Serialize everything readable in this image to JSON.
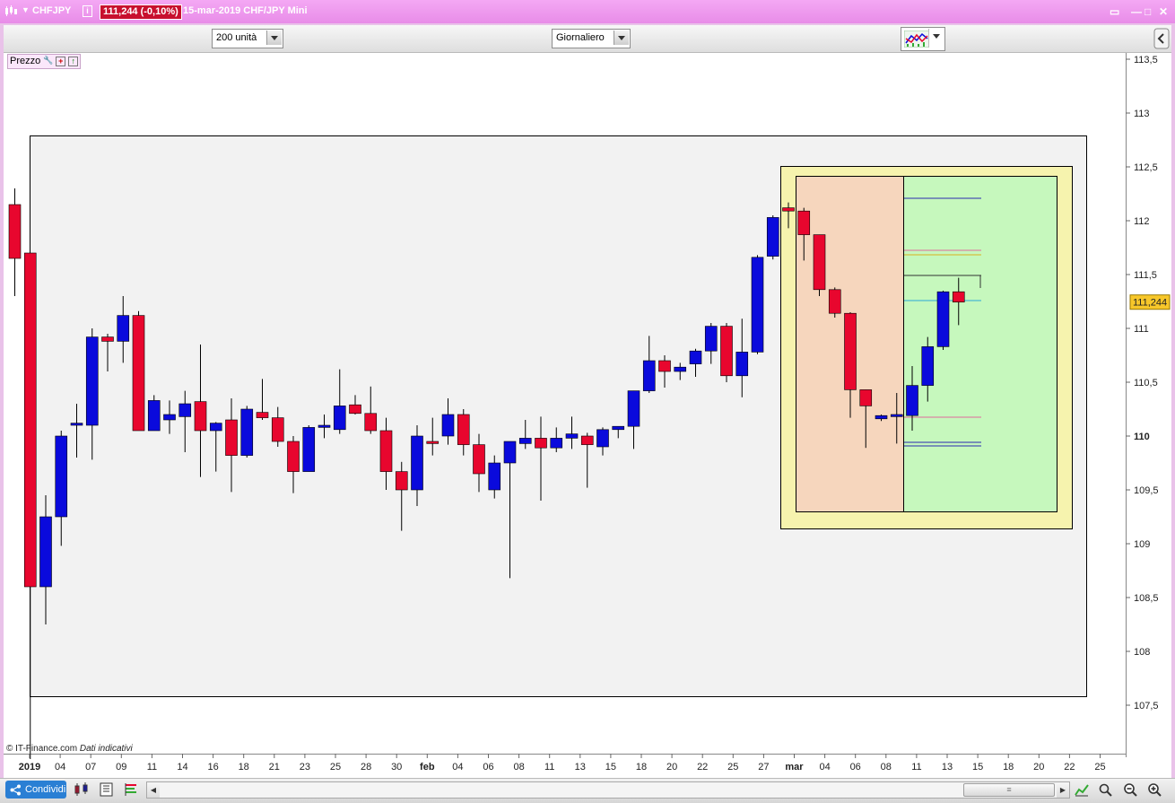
{
  "window": {
    "symbol": "CHFJPY",
    "info_label": "i",
    "price_badge": "111,244 (-0,10%)",
    "title": "15-mar-2019 CHF/JPY Mini",
    "win_buttons": [
      "▭",
      "—",
      "□",
      "✕"
    ]
  },
  "toolbar": {
    "units_value": "200 unità",
    "period_value": "Giornaliero"
  },
  "chart": {
    "panel_label": "Prezzo",
    "copyright": "© IT-Finance.com",
    "copyright_note": "Dati indicativi",
    "current_price_label": "111,244"
  },
  "bottombar": {
    "share_label": "Condividi",
    "scroll_thumb": "≡"
  },
  "colors": {
    "up": "#0a0adc",
    "down": "#e8062e",
    "price_tag": "#f7c72a",
    "outer_frame_bg": "#f2f2f2",
    "yellow_box": "#f6f3ae",
    "orange_zone": "#f6d6bd",
    "green_zone": "#c6f8bd"
  },
  "chart_data": {
    "type": "candlestick",
    "ylim": [
      107,
      113.6
    ],
    "y_ticks": [
      "113,5",
      "113",
      "112,5",
      "112",
      "111,5",
      "111",
      "110,5",
      "110",
      "109,5",
      "109",
      "108,5",
      "108",
      "107,5"
    ],
    "y_tick_values": [
      113.5,
      113,
      112.5,
      112,
      111.5,
      111,
      110.5,
      110,
      109.5,
      109,
      108.5,
      108,
      107.5
    ],
    "y_bold_tick": "110",
    "x_labels": [
      "2019",
      "04",
      "07",
      "09",
      "11",
      "14",
      "16",
      "18",
      "21",
      "23",
      "25",
      "28",
      "30",
      "feb",
      "04",
      "06",
      "08",
      "11",
      "13",
      "15",
      "18",
      "20",
      "22",
      "25",
      "27",
      "mar",
      "04",
      "06",
      "08",
      "11",
      "13",
      "15",
      "18",
      "20",
      "22",
      "25"
    ],
    "x_label_bold": [
      "2019",
      "feb",
      "mar"
    ],
    "last_price": 111.244,
    "candles": [
      {
        "o": 112.15,
        "h": 112.3,
        "l": 111.3,
        "c": 111.65
      },
      {
        "o": 111.7,
        "h": 111.7,
        "l": 107.0,
        "c": 108.6
      },
      {
        "o": 108.6,
        "h": 109.45,
        "l": 108.25,
        "c": 109.25
      },
      {
        "o": 109.25,
        "h": 110.05,
        "l": 108.98,
        "c": 110.0
      },
      {
        "o": 110.1,
        "h": 110.3,
        "l": 109.8,
        "c": 110.12
      },
      {
        "o": 110.1,
        "h": 111.0,
        "l": 109.78,
        "c": 110.92
      },
      {
        "o": 110.92,
        "h": 110.95,
        "l": 110.6,
        "c": 110.88
      },
      {
        "o": 110.88,
        "h": 111.3,
        "l": 110.68,
        "c": 111.12
      },
      {
        "o": 111.12,
        "h": 111.16,
        "l": 110.05,
        "c": 110.05
      },
      {
        "o": 110.05,
        "h": 110.38,
        "l": 110.05,
        "c": 110.33
      },
      {
        "o": 110.15,
        "h": 110.33,
        "l": 110.02,
        "c": 110.2
      },
      {
        "o": 110.18,
        "h": 110.42,
        "l": 109.85,
        "c": 110.3
      },
      {
        "o": 110.32,
        "h": 110.85,
        "l": 109.62,
        "c": 110.05
      },
      {
        "o": 110.05,
        "h": 110.13,
        "l": 109.67,
        "c": 110.12
      },
      {
        "o": 110.15,
        "h": 110.35,
        "l": 109.48,
        "c": 109.82
      },
      {
        "o": 109.82,
        "h": 110.28,
        "l": 109.8,
        "c": 110.25
      },
      {
        "o": 110.22,
        "h": 110.53,
        "l": 110.15,
        "c": 110.17
      },
      {
        "o": 110.17,
        "h": 110.27,
        "l": 109.9,
        "c": 109.95
      },
      {
        "o": 109.95,
        "h": 110.0,
        "l": 109.47,
        "c": 109.67
      },
      {
        "o": 109.67,
        "h": 110.1,
        "l": 109.67,
        "c": 110.08
      },
      {
        "o": 110.08,
        "h": 110.2,
        "l": 109.98,
        "c": 110.1
      },
      {
        "o": 110.06,
        "h": 110.62,
        "l": 110.02,
        "c": 110.28
      },
      {
        "o": 110.29,
        "h": 110.38,
        "l": 110.2,
        "c": 110.21
      },
      {
        "o": 110.21,
        "h": 110.46,
        "l": 110.02,
        "c": 110.05
      },
      {
        "o": 110.05,
        "h": 110.17,
        "l": 109.5,
        "c": 109.67
      },
      {
        "o": 109.67,
        "h": 109.76,
        "l": 109.12,
        "c": 109.5
      },
      {
        "o": 109.5,
        "h": 110.1,
        "l": 109.35,
        "c": 110.0
      },
      {
        "o": 109.95,
        "h": 110.17,
        "l": 109.82,
        "c": 109.93
      },
      {
        "o": 110.0,
        "h": 110.35,
        "l": 109.92,
        "c": 110.2
      },
      {
        "o": 110.2,
        "h": 110.25,
        "l": 109.82,
        "c": 109.92
      },
      {
        "o": 109.92,
        "h": 110.02,
        "l": 109.48,
        "c": 109.65
      },
      {
        "o": 109.5,
        "h": 109.82,
        "l": 109.42,
        "c": 109.75
      },
      {
        "o": 109.75,
        "h": 109.88,
        "l": 108.68,
        "c": 109.95
      },
      {
        "o": 109.93,
        "h": 110.15,
        "l": 109.88,
        "c": 109.98
      },
      {
        "o": 109.98,
        "h": 110.18,
        "l": 109.4,
        "c": 109.89
      },
      {
        "o": 109.89,
        "h": 110.08,
        "l": 109.85,
        "c": 109.98
      },
      {
        "o": 109.98,
        "h": 110.18,
        "l": 109.88,
        "c": 110.02
      },
      {
        "o": 110.0,
        "h": 110.03,
        "l": 109.52,
        "c": 109.92
      },
      {
        "o": 109.9,
        "h": 110.08,
        "l": 109.82,
        "c": 110.06
      },
      {
        "o": 110.06,
        "h": 110.08,
        "l": 109.98,
        "c": 110.09
      },
      {
        "o": 110.09,
        "h": 110.42,
        "l": 109.88,
        "c": 110.42
      },
      {
        "o": 110.42,
        "h": 110.93,
        "l": 110.4,
        "c": 110.7
      },
      {
        "o": 110.7,
        "h": 110.75,
        "l": 110.45,
        "c": 110.6
      },
      {
        "o": 110.6,
        "h": 110.68,
        "l": 110.52,
        "c": 110.64
      },
      {
        "o": 110.67,
        "h": 110.81,
        "l": 110.55,
        "c": 110.79
      },
      {
        "o": 110.79,
        "h": 111.05,
        "l": 110.67,
        "c": 111.02
      },
      {
        "o": 111.02,
        "h": 111.05,
        "l": 110.5,
        "c": 110.56
      },
      {
        "o": 110.56,
        "h": 111.09,
        "l": 110.36,
        "c": 110.78
      },
      {
        "o": 110.78,
        "h": 111.68,
        "l": 110.76,
        "c": 111.66
      },
      {
        "o": 111.67,
        "h": 112.05,
        "l": 111.64,
        "c": 112.03
      },
      {
        "o": 112.12,
        "h": 112.17,
        "l": 111.93,
        "c": 112.09
      },
      {
        "o": 112.09,
        "h": 112.12,
        "l": 111.63,
        "c": 111.87
      },
      {
        "o": 111.87,
        "h": 111.87,
        "l": 111.3,
        "c": 111.36
      },
      {
        "o": 111.36,
        "h": 111.38,
        "l": 111.1,
        "c": 111.14
      },
      {
        "o": 111.14,
        "h": 111.15,
        "l": 110.17,
        "c": 110.43
      },
      {
        "o": 110.43,
        "h": 110.43,
        "l": 109.89,
        "c": 110.28
      },
      {
        "o": 110.16,
        "h": 110.2,
        "l": 110.14,
        "c": 110.19
      },
      {
        "o": 110.18,
        "h": 110.4,
        "l": 109.93,
        "c": 110.2
      },
      {
        "o": 110.19,
        "h": 110.65,
        "l": 110.05,
        "c": 110.47
      },
      {
        "o": 110.47,
        "h": 110.92,
        "l": 110.32,
        "c": 110.83
      },
      {
        "o": 110.83,
        "h": 111.35,
        "l": 110.8,
        "c": 111.34
      },
      {
        "o": 111.34,
        "h": 111.47,
        "l": 111.03,
        "c": 111.244
      }
    ]
  }
}
